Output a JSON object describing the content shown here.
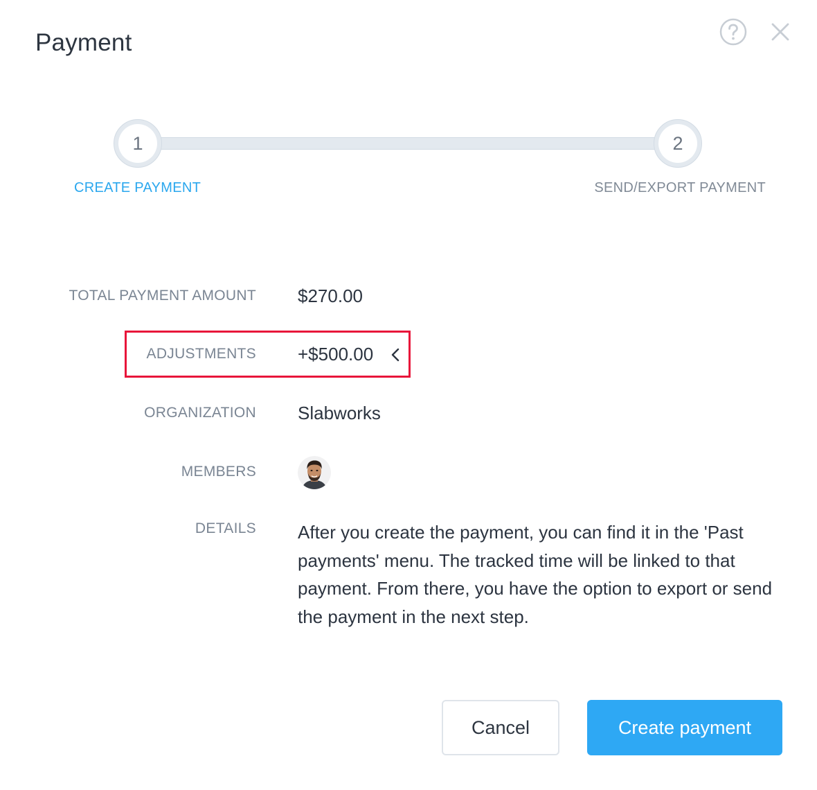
{
  "dialog": {
    "title": "Payment"
  },
  "stepper": {
    "steps": [
      {
        "number": "1",
        "label": "CREATE PAYMENT",
        "active": true
      },
      {
        "number": "2",
        "label": "SEND/EXPORT PAYMENT",
        "active": false
      }
    ]
  },
  "form": {
    "total_label": "TOTAL PAYMENT AMOUNT",
    "total_value": "$270.00",
    "adjustments_label": "ADJUSTMENTS",
    "adjustments_value": "+$500.00",
    "organization_label": "ORGANIZATION",
    "organization_value": "Slabworks",
    "members_label": "MEMBERS",
    "details_label": "DETAILS",
    "details_text": "After you create the payment, you can find it in the 'Past payments' menu. The tracked time will be linked to that payment. From there, you have the option to export or send the payment in the next step."
  },
  "buttons": {
    "cancel_label": "Cancel",
    "create_label": "Create payment"
  },
  "icons": {
    "help": "help-circle-icon",
    "close": "close-icon",
    "adjustments_toggle": "chevron-left-icon"
  },
  "colors": {
    "accent": "#2ea8f4",
    "active_step": "#2aa7ee",
    "highlight": "#e8153a"
  }
}
